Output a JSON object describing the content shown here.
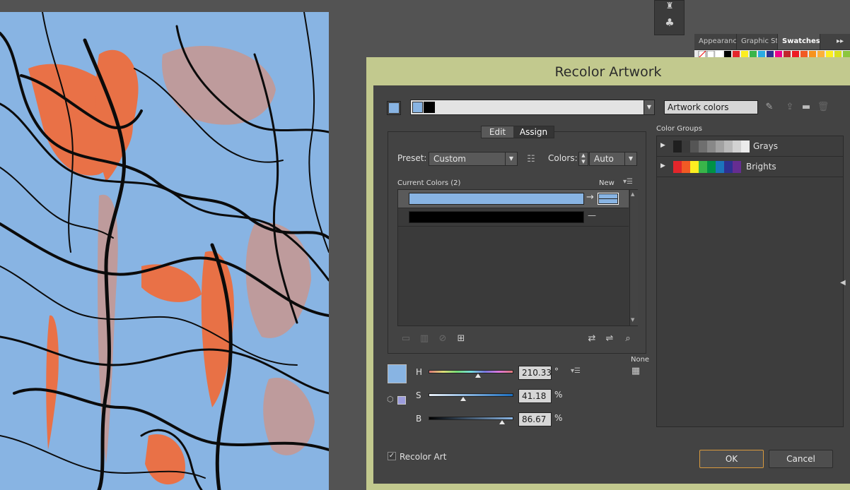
{
  "panel_tabs": [
    {
      "label": "Appearanc"
    },
    {
      "label": "Graphic Sty"
    },
    {
      "label": "Swatches"
    }
  ],
  "dialog": {
    "title": "Recolor Artwork",
    "color_group_name": "Artwork colors",
    "tabs": {
      "edit": "Edit",
      "assign": "Assign"
    },
    "preset_label": "Preset:",
    "preset_value": "Custom",
    "colors_label": "Colors:",
    "colors_value": "Auto",
    "current_colors_label": "Current Colors (2)",
    "new_label": "New",
    "current_colors": [
      {
        "color": "#88b4e3",
        "new_color": "#88b4e3"
      },
      {
        "color": "#000000",
        "new_color": ""
      }
    ],
    "none_label": "None",
    "hsb": {
      "h_label": "H",
      "h_value": "210.33",
      "h_unit": "°",
      "s_label": "S",
      "s_value": "41.18",
      "s_unit": "%",
      "b_label": "B",
      "b_value": "86.67",
      "b_unit": "%",
      "h_fraction": 0.584,
      "s_fraction": 0.412,
      "b_fraction": 0.867
    },
    "color_groups_label": "Color Groups",
    "color_groups": [
      {
        "name": "Grays",
        "colors": [
          "#1f1f1f",
          "#3a3a3a",
          "#555555",
          "#6f6f6f",
          "#888888",
          "#a1a1a1",
          "#b9b9b9",
          "#d2d2d2",
          "#ebebeb",
          "#ffffff"
        ]
      },
      {
        "name": "Brights",
        "colors": [
          "#e3262b",
          "#f15a24",
          "#fcee21",
          "#39b54a",
          "#009245",
          "#1b75bc",
          "#2e3192",
          "#662d91"
        ]
      }
    ],
    "recolor_art_label": "Recolor Art",
    "recolor_art_checked": true,
    "ok_label": "OK",
    "cancel_label": "Cancel"
  },
  "colors": {
    "artwork_bg": "#88b4e3",
    "accent_orange": "#f0703f",
    "dialog_frame": "#c2c98e",
    "dialog_bg": "#434343"
  }
}
